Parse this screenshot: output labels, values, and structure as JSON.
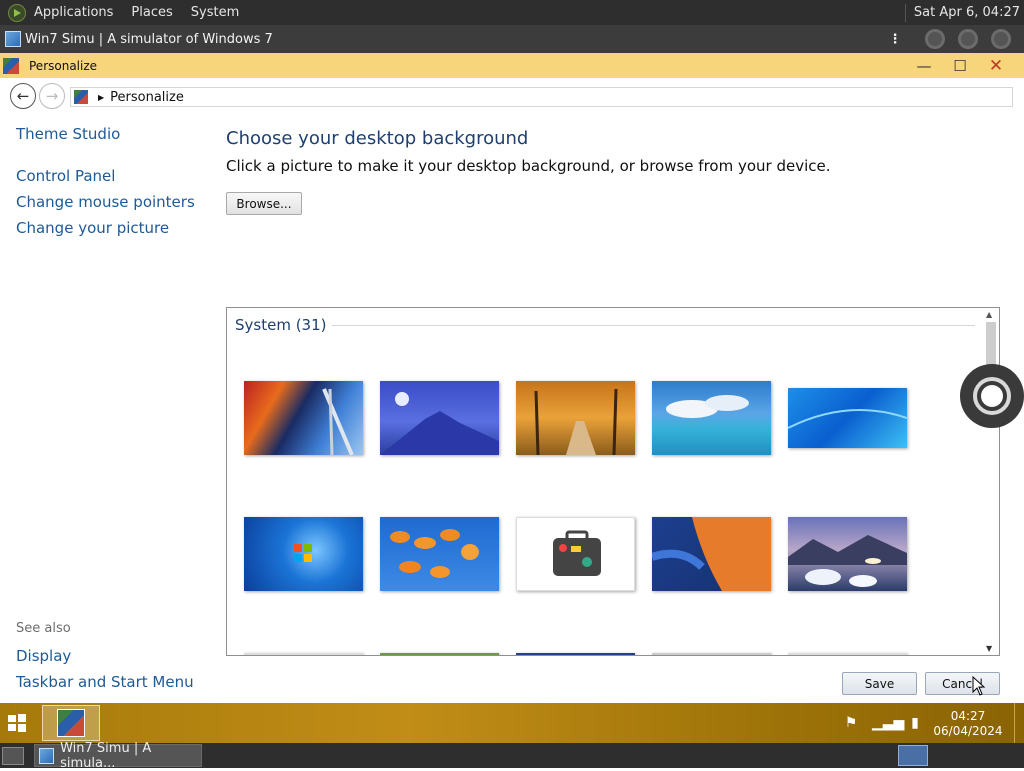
{
  "top_panel": {
    "menus": [
      "Applications",
      "Places",
      "System"
    ],
    "clock": "Sat Apr  6, 04:27"
  },
  "browser": {
    "title": "Win7 Simu | A simulator of Windows 7",
    "menu_icon": "kebab-icon"
  },
  "window": {
    "title": "Personalize",
    "controls": {
      "minimize": "—",
      "maximize": "☐",
      "close": "✕"
    }
  },
  "address_bar": {
    "path": "Personalize",
    "back": "←",
    "forward": "→"
  },
  "sidebar": {
    "top_link": "Theme Studio",
    "links": [
      "Control Panel",
      "Change mouse pointers",
      "Change your picture"
    ],
    "see_also_label": "See also",
    "see_also_links": [
      "Display",
      "Taskbar and Start Menu"
    ]
  },
  "main": {
    "heading": "Choose your desktop background",
    "subtitle": "Click a picture to make it your desktop background, or browse from your device.",
    "browse_label": "Browse...",
    "group_label": "System (31)"
  },
  "buttons": {
    "save": "Save",
    "cancel": "Cancel"
  },
  "taskbar": {
    "time": "04:27",
    "date": "06/04/2024"
  },
  "bottom_panel": {
    "task_label": "Win7 Simu | A simula..."
  }
}
